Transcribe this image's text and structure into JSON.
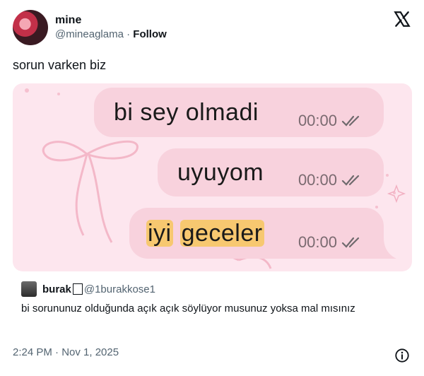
{
  "tweet": {
    "display_name": "mine",
    "handle": "@mineaglama",
    "separator": "·",
    "follow_label": "Follow",
    "text": "sorun varken biz",
    "timestamp": "2:24 PM · Nov 1, 2025"
  },
  "media": {
    "messages": [
      {
        "text": "bi sey olmadi",
        "time": "00:00"
      },
      {
        "text": "uyuyom",
        "time": "00:00"
      },
      {
        "text_parts": [
          "iyi",
          "geceler"
        ],
        "time": "00:00"
      }
    ]
  },
  "quote": {
    "name": "burak",
    "handle": "@1burakkose1",
    "text": "bi sorununuz olduğunda açık açık söylüyor musunuz yoksa mal mısınız"
  },
  "icons": {
    "x_logo": "x-logo-icon",
    "ticks": "double-check-icon",
    "info": "info-icon"
  },
  "colors": {
    "bubble": "#f8d2dd",
    "highlight": "#f7c870",
    "secondary_text": "#536471"
  }
}
